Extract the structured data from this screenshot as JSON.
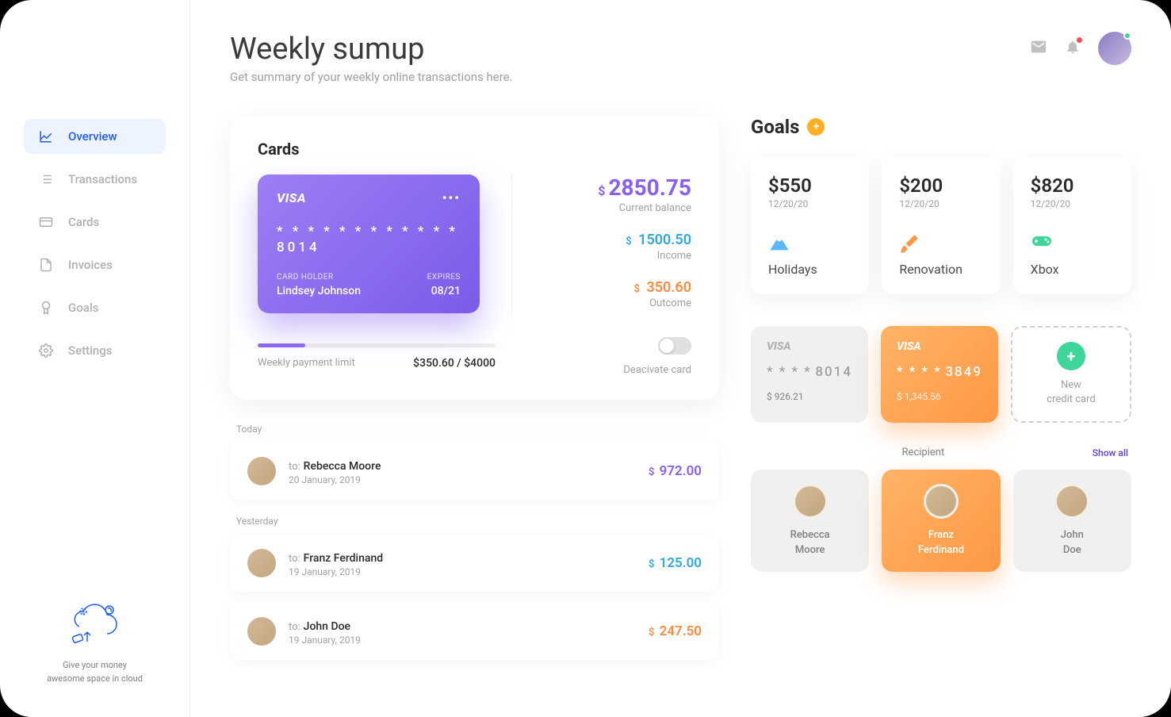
{
  "header": {
    "title": "Weekly sumup",
    "subtitle": "Get summary of your weekly online transactions here."
  },
  "sidebar": {
    "items": [
      {
        "label": "Overview",
        "active": true
      },
      {
        "label": "Transactions"
      },
      {
        "label": "Cards"
      },
      {
        "label": "Invoices"
      },
      {
        "label": "Goals"
      },
      {
        "label": "Settings"
      }
    ],
    "footer_line1": "Give your money",
    "footer_line2": "awesome space in cloud"
  },
  "cards_panel": {
    "title": "Cards",
    "card": {
      "brand": "VISA",
      "number": "* * * *    * * * *    * * * *    8014",
      "holder_label": "CARD HOLDER",
      "holder": "Lindsey Johnson",
      "expires_label": "EXPIRES",
      "expires": "08/21"
    },
    "balance": {
      "amount": "2850.75",
      "label": "Current balance"
    },
    "income": {
      "amount": "1500.50",
      "label": "Income"
    },
    "outcome": {
      "amount": "350.60",
      "label": "Outcome"
    },
    "limit_label": "Weekly payment limit",
    "limit_value": "$350.60 / $4000",
    "deactivate_label": "Deacivate card"
  },
  "transactions": {
    "today_label": "Today",
    "yesterday_label": "Yesterday",
    "to_prefix": "to:",
    "today": [
      {
        "name": "Rebecca Moore",
        "date": "20 January, 2019",
        "amount": "972.00",
        "color": "purple"
      }
    ],
    "yesterday": [
      {
        "name": "Franz Ferdinand",
        "date": "19 January, 2019",
        "amount": "125.00",
        "color": "blue"
      },
      {
        "name": "John Doe",
        "date": "19 January, 2019",
        "amount": "247.50",
        "color": "orange"
      }
    ]
  },
  "goals": {
    "title": "Goals",
    "items": [
      {
        "amount": "$550",
        "date": "12/20/20",
        "name": "Holidays"
      },
      {
        "amount": "$200",
        "date": "12/20/20",
        "name": "Renovation"
      },
      {
        "amount": "$820",
        "date": "12/20/20",
        "name": "Xbox"
      }
    ]
  },
  "mini_cards": [
    {
      "brand": "VISA",
      "last4": "8014",
      "balance": "$ 926.21"
    },
    {
      "brand": "VISA",
      "last4": "3849",
      "balance": "$ 1,345.56"
    }
  ],
  "new_card": {
    "line1": "New",
    "line2": "credit card"
  },
  "recipients": {
    "label": "Recipient",
    "show_all": "Show all",
    "items": [
      {
        "first": "Rebecca",
        "last": "Moore"
      },
      {
        "first": "Franz",
        "last": "Ferdinand",
        "selected": true
      },
      {
        "first": "John",
        "last": "Doe"
      }
    ]
  }
}
